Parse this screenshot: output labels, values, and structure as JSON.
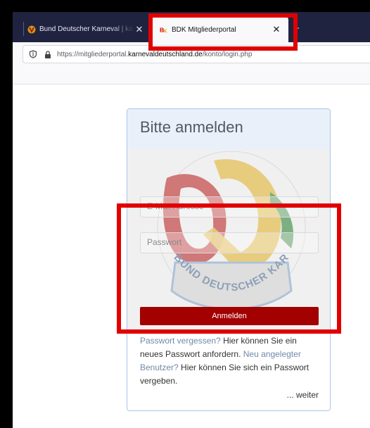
{
  "browser": {
    "tabs": [
      {
        "title": "Bund Deutscher Karneval | karneval",
        "active": false
      },
      {
        "title": "BDK Mitgliederportal",
        "active": true
      }
    ],
    "close_glyph": "✕",
    "new_tab_glyph": "+",
    "url": {
      "prefix": "https://mitgliederportal.",
      "domain": "karnevaldeutschland.de",
      "path": "/konto/login.php"
    }
  },
  "login": {
    "title": "Bitte anmelden",
    "email_placeholder": "E-Mail Adresse",
    "password_placeholder": "Passwort",
    "submit_label": "Anmelden",
    "logo_text": "BUND DEUTSCHER KARNEVAL e.V."
  },
  "footer": {
    "forgot_link": "Passwort vergessen?",
    "forgot_text": " Hier können Sie ein neues Passwort anfordern. ",
    "new_user_link": "Neu angelegter Benutzer?",
    "new_user_text": " Hier können Sie sich ein Passwort vergeben.",
    "more": "... weiter"
  },
  "colors": {
    "accent_red": "#a30000",
    "highlight_red": "#e10000",
    "tabbar": "#202340"
  }
}
